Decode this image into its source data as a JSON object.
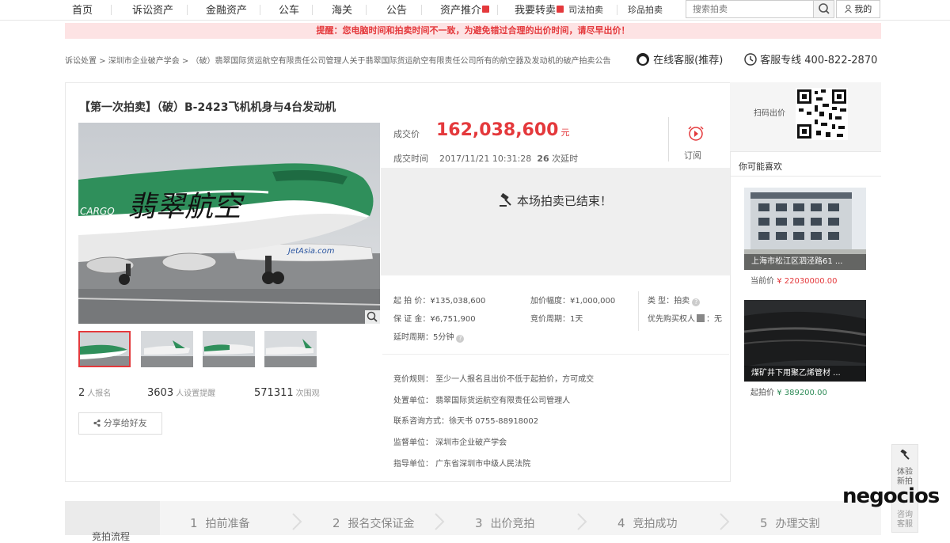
{
  "nav": {
    "items": [
      {
        "label": "首页",
        "hot": false
      },
      {
        "label": "诉讼资产",
        "hot": false
      },
      {
        "label": "金融资产",
        "hot": false
      },
      {
        "label": "公车",
        "hot": false
      },
      {
        "label": "海关",
        "hot": false
      },
      {
        "label": "公告",
        "hot": false
      },
      {
        "label": "资产推介",
        "hot": true
      },
      {
        "label": "我要转卖",
        "hot": true
      }
    ],
    "extra": [
      "司法拍卖",
      "珍品拍卖"
    ],
    "search_placeholder": "搜索拍卖",
    "mine": "我的"
  },
  "warning": "提醒：您电脑时间和拍卖时间不一致，为避免错过合理的出价时间，请尽早出价！",
  "breadcrumb": "诉讼处置 > 深圳市企业破产学会 > （破）翡翠国际货运航空有限责任公司管理人关于翡翠国际货运航空有限责任公司所有的航空器及发动机的破产拍卖公告",
  "service": {
    "online": "在线客服(推荐)",
    "hotline": "客服专线 400-822-2870"
  },
  "lot": {
    "title": "【第一次拍卖】（破）B-2423飞机机身与4台发动机",
    "price_label": "成交价",
    "price": "162,038,600",
    "price_unit": "元",
    "deal_time_label": "成交时间",
    "deal_time": "2017/11/21 10:31:28",
    "extensions": "26",
    "extensions_label": "次延时",
    "subscribe": "订阅",
    "ended": "本场拍卖已结束！",
    "aircraft_text": "翡翠航空",
    "aircraft_cargo": "CARGO",
    "other_plane": "JetAsia.com"
  },
  "stats": [
    {
      "value": "2",
      "label": "人报名"
    },
    {
      "value": "3603",
      "label": "人设置提醒"
    },
    {
      "value": "571311",
      "label": "次围观"
    }
  ],
  "share": "分享给好友",
  "details": {
    "start": "起 拍 价：¥135,038,600",
    "deposit": "保 证 金：¥6,751,900",
    "delay": "延时周期：5分钟",
    "increment": "加价幅度：¥1,000,000",
    "cycle": "竞价周期：1天",
    "type_label": "类    型：",
    "type_value": "拍卖",
    "priority": "优先购买权人",
    "priority_value": "无"
  },
  "rules": [
    "竞价规则：  至少一人报名且出价不低于起拍价，方可成交",
    "处置单位：  翡翠国际货运航空有限责任公司管理人",
    "联系咨询方式：徐天书      0755-88918002",
    "监督单位：  深圳市企业破产学会",
    "指导单位：  广东省深圳市中级人民法院"
  ],
  "sidebar": {
    "qr_label": "扫码出价",
    "rec_title": "你可能喜欢",
    "recs": [
      {
        "caption": "上海市松江区泗泾路61 ...",
        "price_label": "当前价",
        "price": "¥ 22030000.00"
      },
      {
        "caption": "煤矿井下用聚乙烯管材 ...",
        "price_label": "起拍价",
        "price": "¥ 389200.00"
      }
    ]
  },
  "float_panel": {
    "item1": "体验新拍",
    "item2": "咨询客服"
  },
  "logo": {
    "main": "negocios"
  },
  "steps": {
    "head": "竞拍流程",
    "items": [
      {
        "n": "1",
        "label": "拍前准备"
      },
      {
        "n": "2",
        "label": "报名交保证金"
      },
      {
        "n": "3",
        "label": "出价竞拍"
      },
      {
        "n": "4",
        "label": "竞拍成功"
      },
      {
        "n": "5",
        "label": "办理交割"
      }
    ]
  },
  "colors": {
    "accent": "#e4393c",
    "jade": "#2e8b57",
    "warn_bg": "#fde3e4"
  }
}
